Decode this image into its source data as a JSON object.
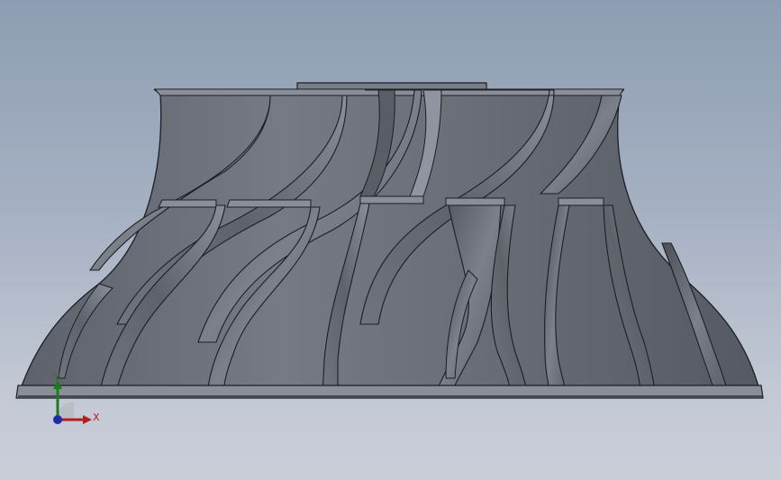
{
  "viewport": {
    "background_top": "#8e9db3",
    "background_bottom": "#c9ced9"
  },
  "model": {
    "body_color": "#6a6e78",
    "edge_color": "#1c1e22",
    "highlight_color": "#8c909a"
  },
  "triad": {
    "x_label": "X",
    "y_label": "Y",
    "x_color": "#b01e1e",
    "y_color": "#1f7a1f",
    "z_color": "#1e2aa6"
  }
}
